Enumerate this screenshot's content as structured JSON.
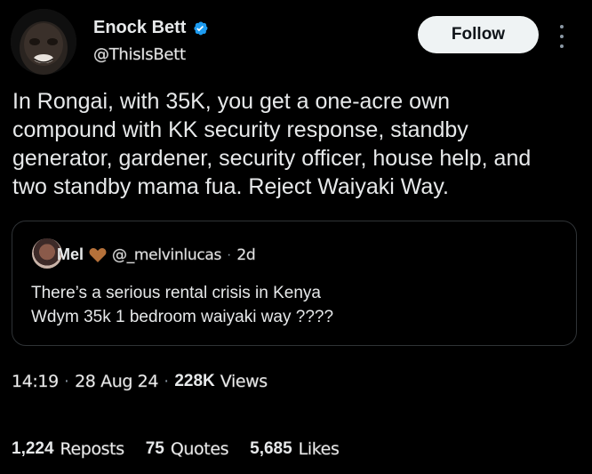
{
  "author": {
    "name": "Enock Bett",
    "handle": "@ThisIsBett",
    "verified_color": "#1d9bf0"
  },
  "follow_button": {
    "label": "Follow"
  },
  "more_menu": {
    "icon": "more-vertical-icon"
  },
  "tweet": {
    "text": "In Rongai, with 35K, you get a one-acre own\ncompound with KK security response, standby\ngenerator, gardener, security officer, house help, and\ntwo standby mama fua. Reject Waiyaki Way."
  },
  "quoted_tweet": {
    "name": "Mel",
    "name_emoji": "brown-heart-icon",
    "handle": "@_melvinlucas",
    "separator": "·",
    "time": "2d",
    "text": "There’s a serious rental crisis in Kenya\nWdym 35k 1 bedroom waiyaki way ????"
  },
  "meta": {
    "time": "14:19",
    "sep1": "·",
    "date": "28 Aug 24",
    "sep2": "·",
    "views_count": "228K",
    "views_label": "Views"
  },
  "stats": {
    "reposts_count": "1,224",
    "reposts_label": "Reposts",
    "quotes_count": "75",
    "quotes_label": "Quotes",
    "likes_count": "5,685",
    "likes_label": "Likes"
  }
}
